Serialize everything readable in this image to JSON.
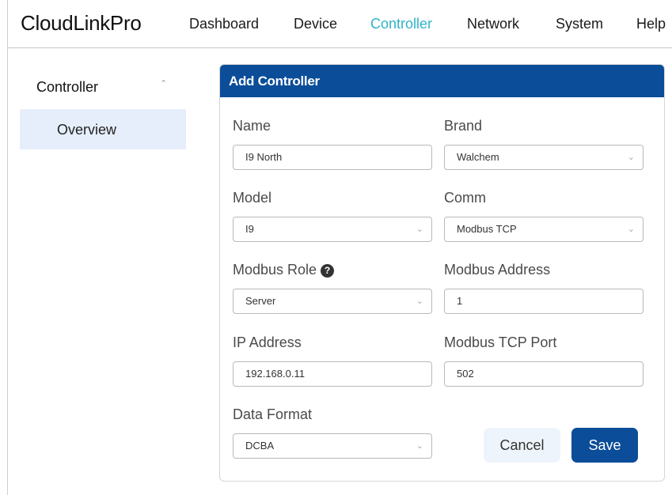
{
  "app": {
    "title": "CloudLinkPro"
  },
  "nav": {
    "items": [
      {
        "label": "Dashboard"
      },
      {
        "label": "Device"
      },
      {
        "label": "Controller"
      },
      {
        "label": "Network"
      },
      {
        "label": "System"
      },
      {
        "label": "Help"
      }
    ],
    "active": "Controller",
    "active_color": "#2fb3c9"
  },
  "sidebar": {
    "section": "Controller",
    "items": [
      {
        "label": "Overview",
        "selected": true
      }
    ]
  },
  "form": {
    "title": "Add Controller",
    "header_color": "#0b4d99",
    "fields": {
      "name": {
        "label": "Name",
        "value": "I9 North"
      },
      "brand": {
        "label": "Brand",
        "value": "Walchem"
      },
      "model": {
        "label": "Model",
        "value": "I9"
      },
      "comm": {
        "label": "Comm",
        "value": "Modbus TCP"
      },
      "modbus_role": {
        "label": "Modbus Role",
        "value": "Server",
        "help_icon": "?"
      },
      "modbus_address": {
        "label": "Modbus Address",
        "value": "1"
      },
      "ip_address": {
        "label": "IP Address",
        "value": "192.168.0.11"
      },
      "modbus_tcp_port": {
        "label": "Modbus TCP Port",
        "value": "502"
      },
      "data_format": {
        "label": "Data Format",
        "value": "DCBA"
      }
    },
    "buttons": {
      "cancel": "Cancel",
      "save": "Save"
    }
  }
}
